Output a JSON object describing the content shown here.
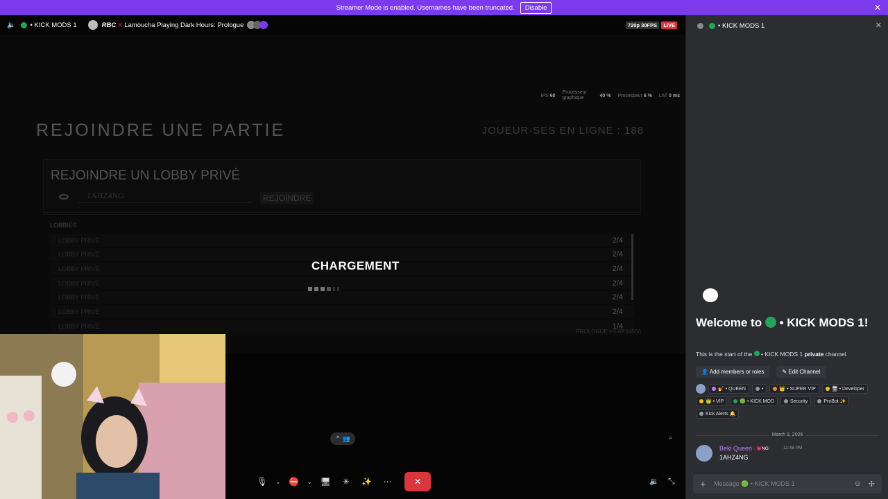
{
  "banner": {
    "text": "Streamer Mode is enabled. Usernames have been truncated.",
    "disable_label": "Disable",
    "close": "✕"
  },
  "stream": {
    "channel_name": "• KICK MODS 1",
    "streamer_prefix": "RBC",
    "stream_title": "Lamoucha Playing Dark Hours: Prologue",
    "quality": "720p 30FPS",
    "live_badge": "LIVE"
  },
  "game": {
    "stats": {
      "ips_label": "IPS",
      "ips_value": "60",
      "gpu_label": "Processeur graphique",
      "gpu_value": "40 %",
      "cpu_label": "Processeur",
      "cpu_value": "6 %",
      "lat_label": "LAT",
      "lat_value": "0 ms"
    },
    "title": "REJOINDRE UNE PARTIE",
    "online": "JOUEUR·SES EN LIGNE : 188",
    "private_title": "REJOINDRE UN LOBBY PRIVÉ",
    "code_value": "1AHZ4NG",
    "join_label": "REJOINDRE",
    "lobbies_label": "LOBBIES",
    "lobbies": [
      {
        "name": "LOBBY PRIVÉ",
        "count": "2/4"
      },
      {
        "name": "LOBBY PRIVÉ",
        "count": "2/4"
      },
      {
        "name": "LOBBY PRIVÉ",
        "count": "2/4"
      },
      {
        "name": "LOBBY PRIVÉ",
        "count": "2/4"
      },
      {
        "name": "LOBBY PRIVÉ",
        "count": "2/4"
      },
      {
        "name": "LOBBY PRIVÉ",
        "count": "2/4"
      },
      {
        "name": "LOBBY PRIVÉ",
        "count": "1/4"
      }
    ],
    "version": "PROLOGUE v 0.6P.14556",
    "loading": "CHARGEMENT"
  },
  "sidebar": {
    "channel": "• KICK MODS 1",
    "welcome": "Welcome to",
    "welcome_channel": "• KICK MODS 1!",
    "start_text_1": "This is the start of the",
    "start_channel": "• KICK MODS 1",
    "start_private": "private",
    "start_text_2": "channel.",
    "add_members": "Add members or roles",
    "edit_channel": "Edit Channel",
    "roles": [
      {
        "label": "💅 • QUEEN",
        "color": "#c77dff"
      },
      {
        "label": "•",
        "color": "#949ba4"
      },
      {
        "label": "👑 • SUPER VIP",
        "color": "#f0883e"
      },
      {
        "label": "🖥 • Developer",
        "color": "#f5c518"
      },
      {
        "label": "👑 • VIP",
        "color": "#f5c518"
      },
      {
        "label": "🟢 • KICK MOD",
        "color": "#23a559"
      },
      {
        "label": "Security",
        "color": "#949ba4"
      },
      {
        "label": "ProBot ✨",
        "color": "#949ba4"
      },
      {
        "label": "Kick Alerts 🔔",
        "color": "#949ba4"
      }
    ],
    "date": "March 3, 2026",
    "message": {
      "user": "Beki Queen",
      "tag": "💗NG",
      "time": "11:48 PM",
      "text": "1AHZ4NG"
    },
    "input_placeholder": "Message 🟢 • KICK MODS 1"
  },
  "colors": {
    "accent": "#7c3aed",
    "live": "#da373c",
    "green": "#23a559"
  }
}
